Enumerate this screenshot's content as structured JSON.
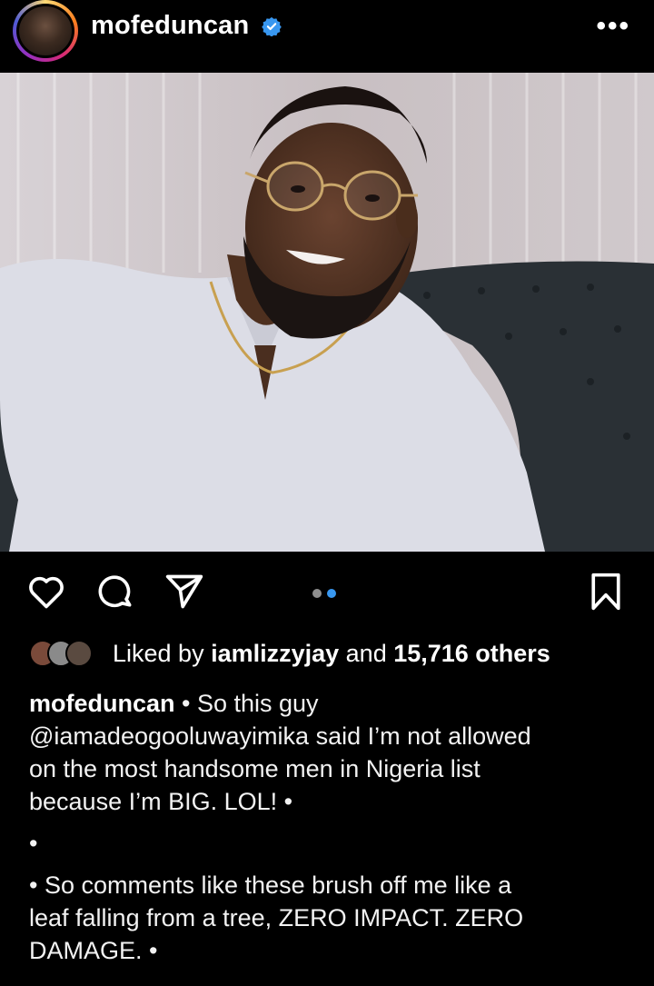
{
  "header": {
    "username": "mofeduncan",
    "more_label": "•••"
  },
  "post": {
    "carousel": {
      "count": 2,
      "active_index": 1
    }
  },
  "likes": {
    "prefix": "Liked by ",
    "user": "iamlizzyjay",
    "middle": " and ",
    "count": "15,716 others"
  },
  "caption": {
    "username": "mofeduncan",
    "line1": " • So this guy",
    "line2": "@iamadeogooluwayimika said I’m not allowed",
    "line3": "on the most handsome men in Nigeria list",
    "line4": "because I’m BIG. LOL! •",
    "line5": "•",
    "line6": "• So comments like these brush off me like a",
    "line7": "leaf falling from a tree, ZERO IMPACT. ZERO",
    "line8": "DAMAGE. •",
    "line9": "•"
  },
  "colors": {
    "background": "#000000",
    "verified": "#3897f0",
    "active_dot": "#3897f0",
    "inactive_dot": "#8e8e8e"
  }
}
